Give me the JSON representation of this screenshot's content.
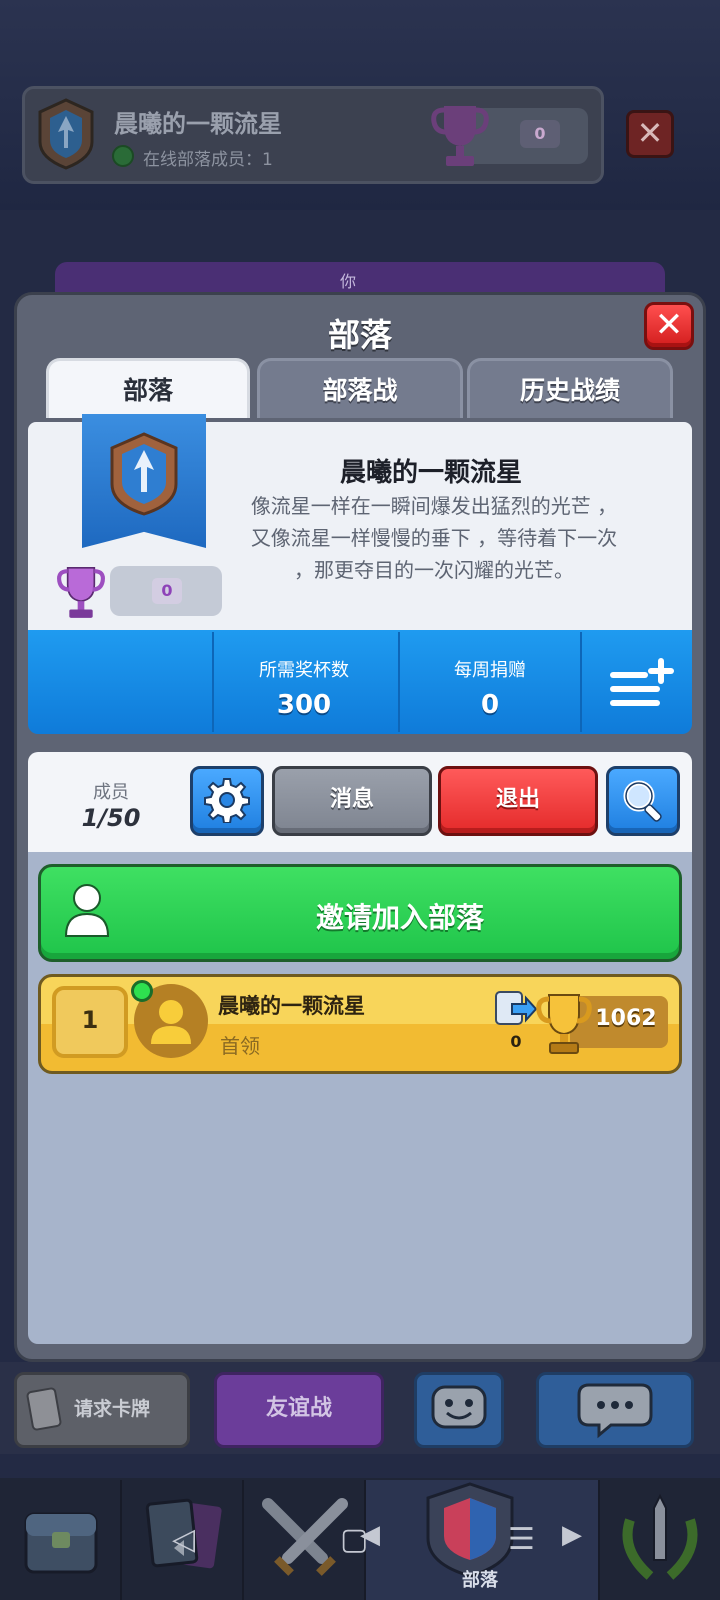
{
  "background": {
    "clan_name": "晨曦的一颗流星",
    "online_members": "在线部落成员：1",
    "trophies": "0",
    "you_label": "你"
  },
  "modal": {
    "title": "部落",
    "tabs": [
      {
        "label": "部落",
        "active": true
      },
      {
        "label": "部落战",
        "active": false
      },
      {
        "label": "历史战绩",
        "active": false
      }
    ]
  },
  "clan": {
    "name": "晨曦的一颗流星",
    "description": "像流星一样在一瞬间爆发出猛烈的光芒 ，又像流星一样慢慢的垂下 ，等待着下一次 ，那更夺目的一次闪耀的光芒。",
    "trophies": "0",
    "stats": [
      {
        "label": "所需奖杯数",
        "value": "300"
      },
      {
        "label": "每周捐赠",
        "value": "0"
      }
    ]
  },
  "members_section": {
    "label": "成员",
    "count": "1/50",
    "buttons": {
      "message": "消息",
      "exit": "退出"
    }
  },
  "invite": {
    "label": "邀请加入部落"
  },
  "members": [
    {
      "rank": "1",
      "name": "晨曦的一颗流星",
      "role": "首领",
      "donations": "0",
      "trophies": "1062",
      "online": true
    }
  ],
  "actions": {
    "request_cards": "请求卡牌",
    "friendly_battle": "友谊战"
  },
  "nav": {
    "active_label": "部落"
  },
  "colors": {
    "accent_blue": "#1f9bf0",
    "invite_green": "#1fc44a",
    "exit_red": "#e42a2a",
    "member_gold": "#f2bb32"
  }
}
